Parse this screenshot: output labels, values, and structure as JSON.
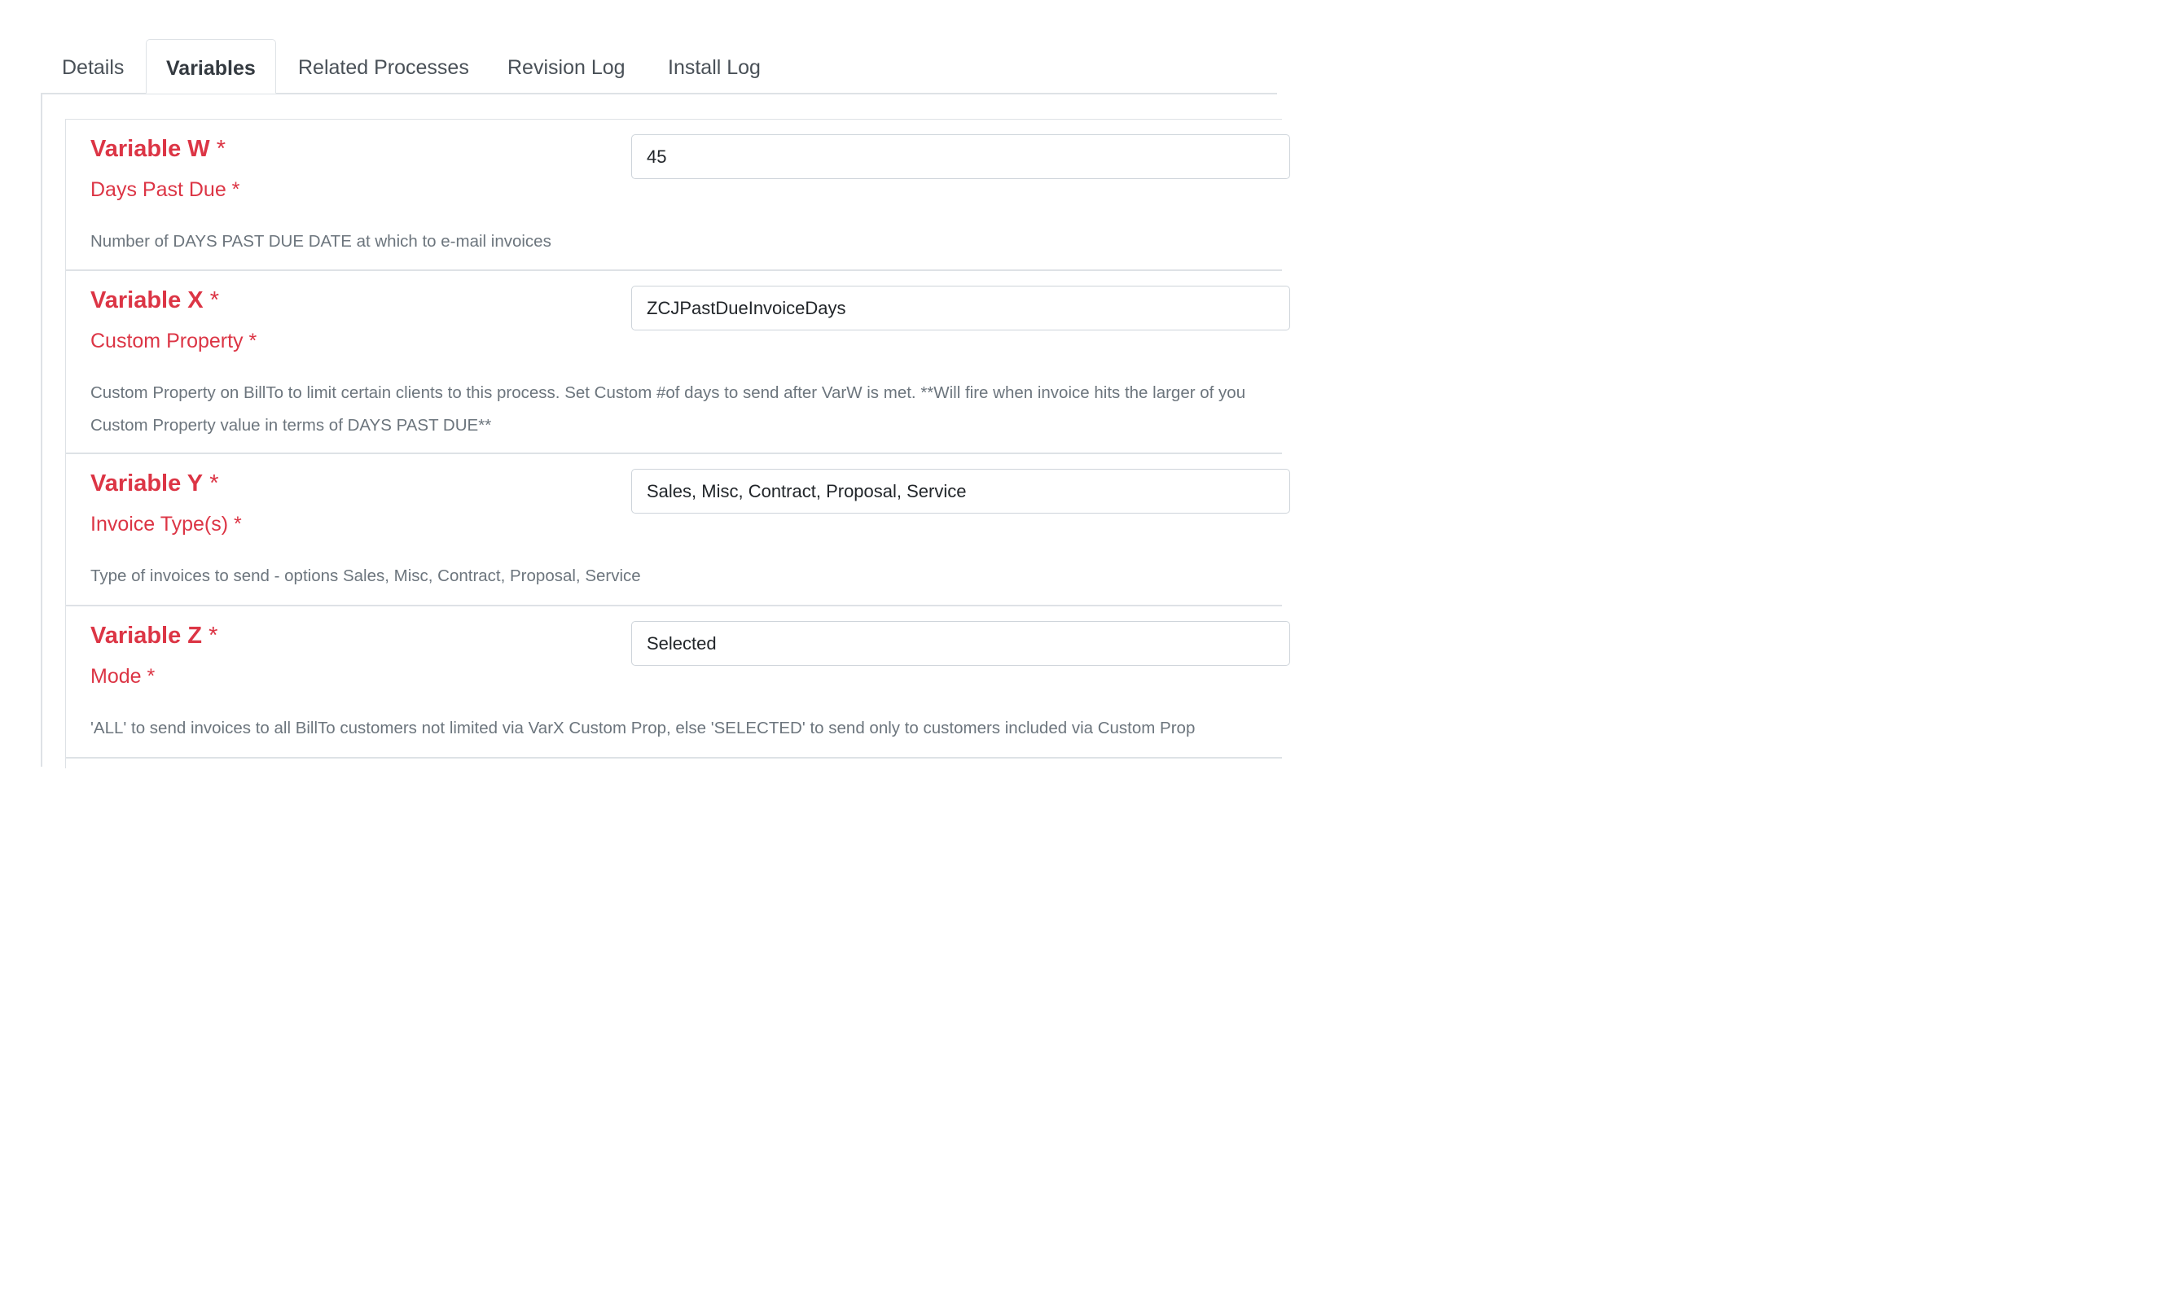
{
  "tabs": [
    {
      "label": "Details",
      "active": false
    },
    {
      "label": "Variables",
      "active": true
    },
    {
      "label": "Related Processes",
      "active": false
    },
    {
      "label": "Revision Log",
      "active": false
    },
    {
      "label": "Install Log",
      "active": false
    }
  ],
  "variables": [
    {
      "name": "Variable W",
      "required_mark": "*",
      "label": "Days Past Due *",
      "value": "45",
      "description": [
        "Number of DAYS PAST DUE DATE at which to e-mail invoices"
      ]
    },
    {
      "name": "Variable X",
      "required_mark": "*",
      "label": "Custom Property *",
      "value": "ZCJPastDueInvoiceDays",
      "description": [
        "Custom Property on BillTo to limit certain clients to this process. Set Custom #of days to send after VarW is met. **Will fire when invoice hits the larger of you",
        "Custom Property value in terms of DAYS PAST DUE**"
      ]
    },
    {
      "name": "Variable Y",
      "required_mark": "*",
      "label": "Invoice Type(s) *",
      "value": "Sales, Misc, Contract, Proposal, Service",
      "description": [
        "Type of invoices to send - options Sales, Misc, Contract, Proposal, Service"
      ]
    },
    {
      "name": "Variable Z",
      "required_mark": "*",
      "label": "Mode *",
      "value": "Selected",
      "description": [
        "'ALL' to send invoices to all BillTo customers not limited via VarX Custom Prop, else 'SELECTED' to send only to customers included via Custom Prop"
      ]
    }
  ]
}
